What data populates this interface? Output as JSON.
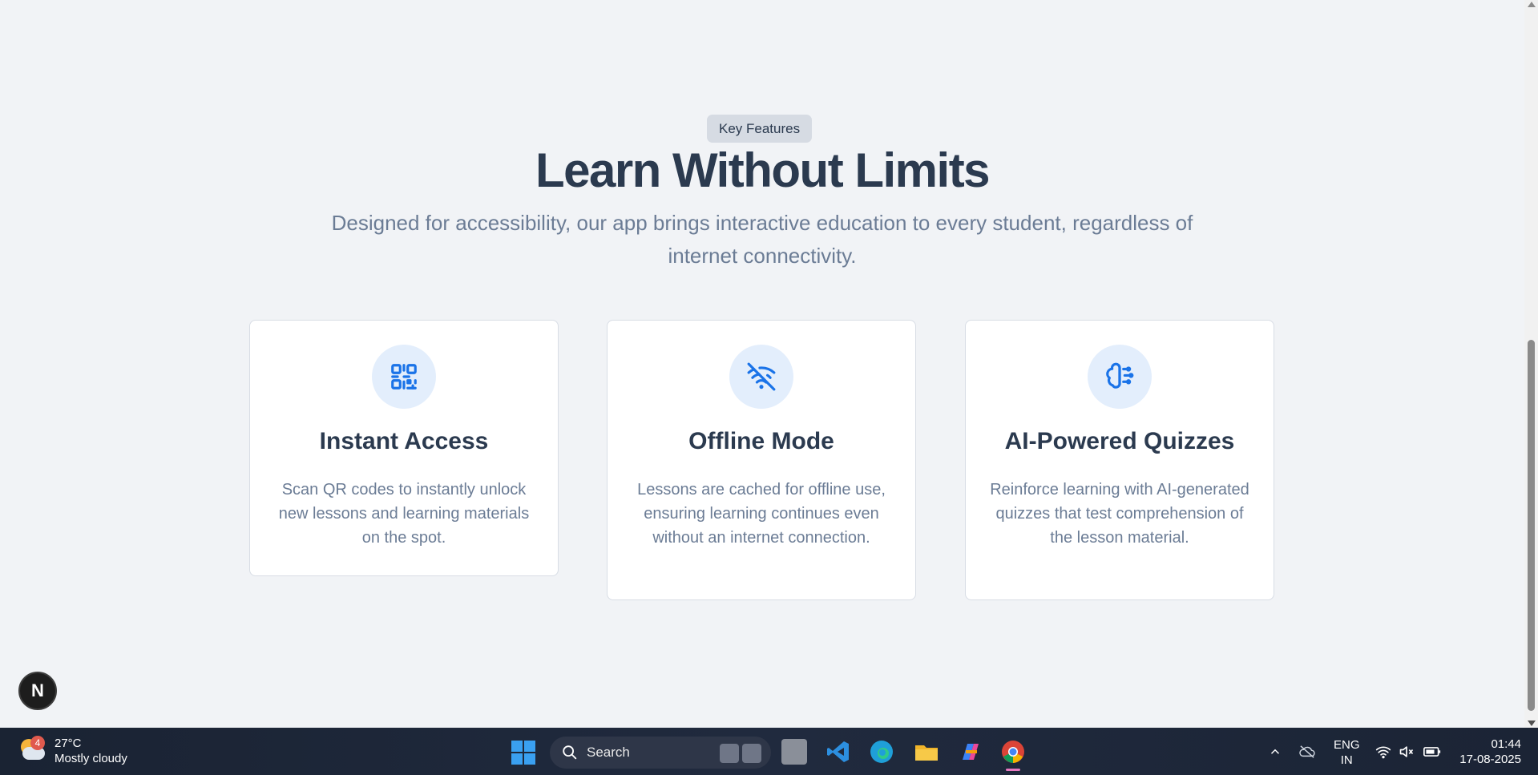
{
  "features": {
    "badge": "Key Features",
    "headline": "Learn Without Limits",
    "subtitle": "Designed for accessibility, our app brings interactive education to every student, regardless of internet connectivity.",
    "cards": [
      {
        "title": "Instant Access",
        "description": "Scan QR codes to instantly unlock new lessons and learning materials on the spot.",
        "icon": "qr-code-icon"
      },
      {
        "title": "Offline Mode",
        "description": "Lessons are cached for offline use, ensuring learning continues even without an internet connection.",
        "icon": "wifi-off-icon"
      },
      {
        "title": "AI-Powered Quizzes",
        "description": "Reinforce learning with AI-generated quizzes that test comprehension of the lesson material.",
        "icon": "brain-icon"
      }
    ],
    "accent_color": "#1a73e8"
  },
  "dev_badge": {
    "label": "N"
  },
  "taskbar": {
    "weather": {
      "temp": "27°C",
      "condition": "Mostly cloudy",
      "notification_count": "4"
    },
    "search_label": "Search",
    "apps": [
      "task-view-icon",
      "vscode-icon",
      "edge-icon",
      "file-explorer-icon",
      "copilot-icon",
      "chrome-icon"
    ],
    "language": {
      "line1": "ENG",
      "line2": "IN"
    },
    "clock": {
      "time": "01:44",
      "date": "17-08-2025"
    }
  }
}
